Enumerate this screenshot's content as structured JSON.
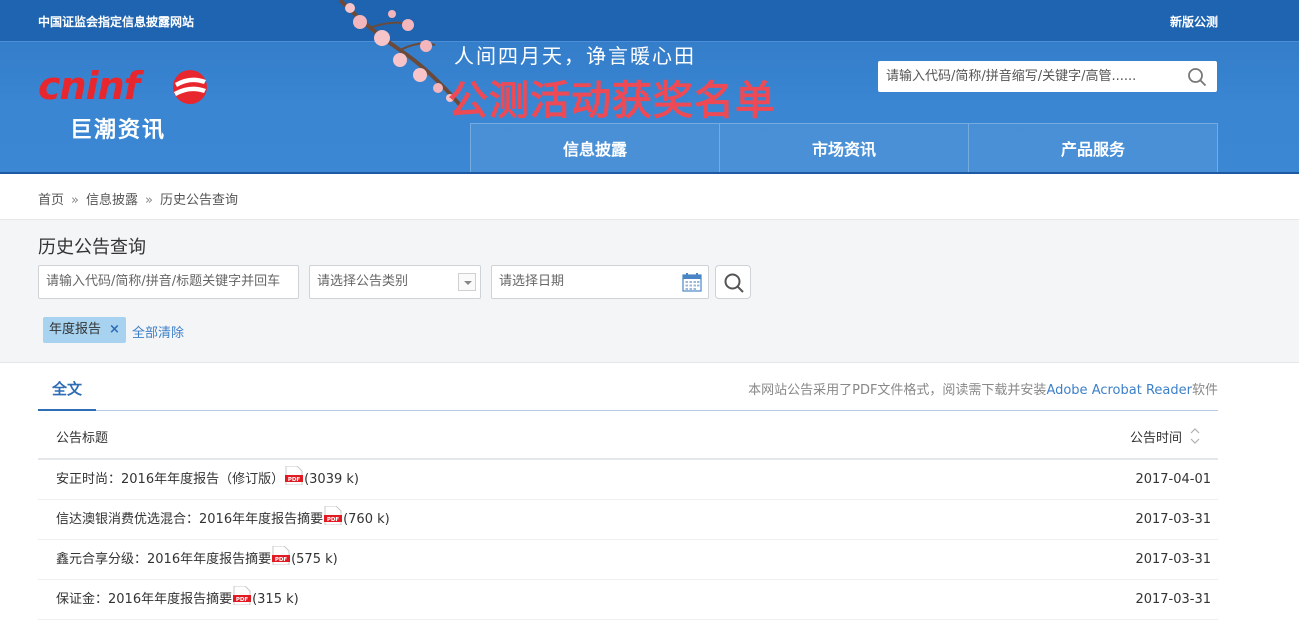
{
  "header": {
    "top_left": "中国证监会指定信息披露网站",
    "top_right": "新版公测",
    "logo_en": "cninf",
    "logo_cn": "巨潮资讯",
    "banner_sub": "人间四月天，诤言暖心田",
    "banner_main": "公测活动获奖名单",
    "search_placeholder": "请输入代码/简称/拼音缩写/关键字/高管......",
    "nav": [
      "信息披露",
      "市场资讯",
      "产品服务"
    ]
  },
  "breadcrumb": [
    "首页",
    "信息披露",
    "历史公告查询"
  ],
  "breadcrumb_sep": "»",
  "filter": {
    "title": "历史公告查询",
    "keyword_placeholder": "请输入代码/简称/拼音/标题关键字并回车",
    "type_placeholder": "请选择公告类别",
    "date_placeholder": "请选择日期",
    "tag": "年度报告",
    "tag_remove": "×",
    "clear_all": "全部清除"
  },
  "tabs": {
    "active": "全文"
  },
  "notice": {
    "prefix": "本网站公告采用了PDF文件格式，阅读需下载并安装",
    "link": "Adobe Acrobat Reader",
    "suffix": "软件"
  },
  "table": {
    "col_title": "公告标题",
    "col_time": "公告时间",
    "rows": [
      {
        "title": "安正时尚：2016年年度报告（修订版）",
        "size": "(3039 k)",
        "date": "2017-04-01"
      },
      {
        "title": "信达澳银消费优选混合：2016年年度报告摘要",
        "size": "(760 k)",
        "date": "2017-03-31"
      },
      {
        "title": "鑫元合享分级：2016年年度报告摘要",
        "size": "(575 k)",
        "date": "2017-03-31"
      },
      {
        "title": "保证金：2016年年度报告摘要",
        "size": "(315 k)",
        "date": "2017-03-31"
      }
    ]
  },
  "colors": {
    "header_blue": "#3a86d2",
    "topbar_blue": "#1f64b0",
    "brand_red": "#e8262e",
    "link_blue": "#3d80c8",
    "tag_bg": "#a7d3f0"
  }
}
